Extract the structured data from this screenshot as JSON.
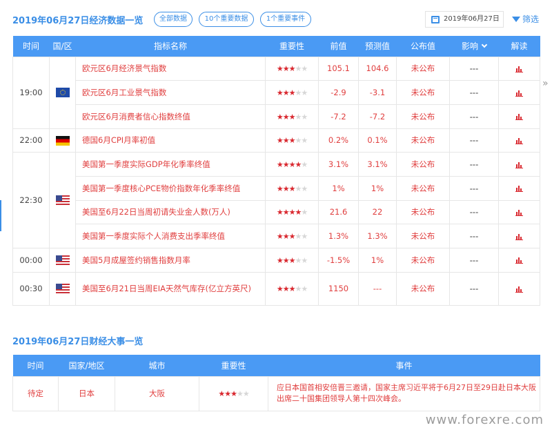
{
  "header": {
    "title": "2019年06月27日经济数据一览",
    "pill_all": "全部数据",
    "pill_important_data": "10个重要数据",
    "pill_important_events": "1个重要事件",
    "date": "2019年06月27日",
    "filter_label": "筛选"
  },
  "table_headers": {
    "time": "时间",
    "country": "国/区",
    "indicator": "指标名称",
    "importance": "重要性",
    "previous": "前值",
    "forecast": "预测值",
    "actual": "公布值",
    "impact": "影响",
    "analysis": "解读"
  },
  "time_groups": [
    "19:00",
    "22:00",
    "22:30",
    "00:00",
    "00:30"
  ],
  "rows": [
    {
      "name": "欧元区6月经济景气指数",
      "stars": 3,
      "previous": "105.1",
      "forecast": "104.6",
      "actual": "未公布",
      "impact": "---"
    },
    {
      "name": "欧元区6月工业景气指数",
      "stars": 3,
      "previous": "-2.9",
      "forecast": "-3.1",
      "actual": "未公布",
      "impact": "---"
    },
    {
      "name": "欧元区6月消费者信心指数终值",
      "stars": 3,
      "previous": "-7.2",
      "forecast": "-7.2",
      "actual": "未公布",
      "impact": "---"
    },
    {
      "name": "德国6月CPI月率初值",
      "stars": 3,
      "previous": "0.2%",
      "forecast": "0.1%",
      "actual": "未公布",
      "impact": "---"
    },
    {
      "name": "美国第一季度实际GDP年化季率终值",
      "stars": 4,
      "previous": "3.1%",
      "forecast": "3.1%",
      "actual": "未公布",
      "impact": "---"
    },
    {
      "name": "美国第一季度核心PCE物价指数年化季率终值",
      "stars": 3,
      "previous": "1%",
      "forecast": "1%",
      "actual": "未公布",
      "impact": "---"
    },
    {
      "name": "美国至6月22日当周初请失业金人数(万人)",
      "stars": 4,
      "previous": "21.6",
      "forecast": "22",
      "actual": "未公布",
      "impact": "---"
    },
    {
      "name": "美国第一季度实际个人消费支出季率终值",
      "stars": 3,
      "previous": "1.3%",
      "forecast": "1.3%",
      "actual": "未公布",
      "impact": "---"
    },
    {
      "name": "美国5月成屋签约销售指数月率",
      "stars": 3,
      "previous": "-1.5%",
      "forecast": "1%",
      "actual": "未公布",
      "impact": "---"
    },
    {
      "name": "美国至6月21日当周EIA天然气库存(亿立方英尺)",
      "stars": 3,
      "previous": "1150",
      "forecast": "---",
      "actual": "未公布",
      "impact": "---"
    }
  ],
  "flags": [
    "eu-flag",
    "germany-flag",
    "us-flag",
    "us-flag",
    "us-flag"
  ],
  "events_section": {
    "title": "2019年06月27日财经大事一览",
    "headers": {
      "time": "时间",
      "country": "国家/地区",
      "city": "城市",
      "importance": "重要性",
      "event": "事件"
    },
    "rows": [
      {
        "time": "待定",
        "country": "日本",
        "city": "大阪",
        "stars": 3,
        "event": "应日本国首相安倍晋三邀请，国家主席习近平将于6月27日至29日赴日本大阪出席二十国集团领导人第十四次峰会。"
      }
    ]
  },
  "watermark": "www.forexre.com",
  "colors": {
    "accent": "#4a9af4",
    "link_red": "#e03e3e",
    "star_red": "#d9282f"
  }
}
